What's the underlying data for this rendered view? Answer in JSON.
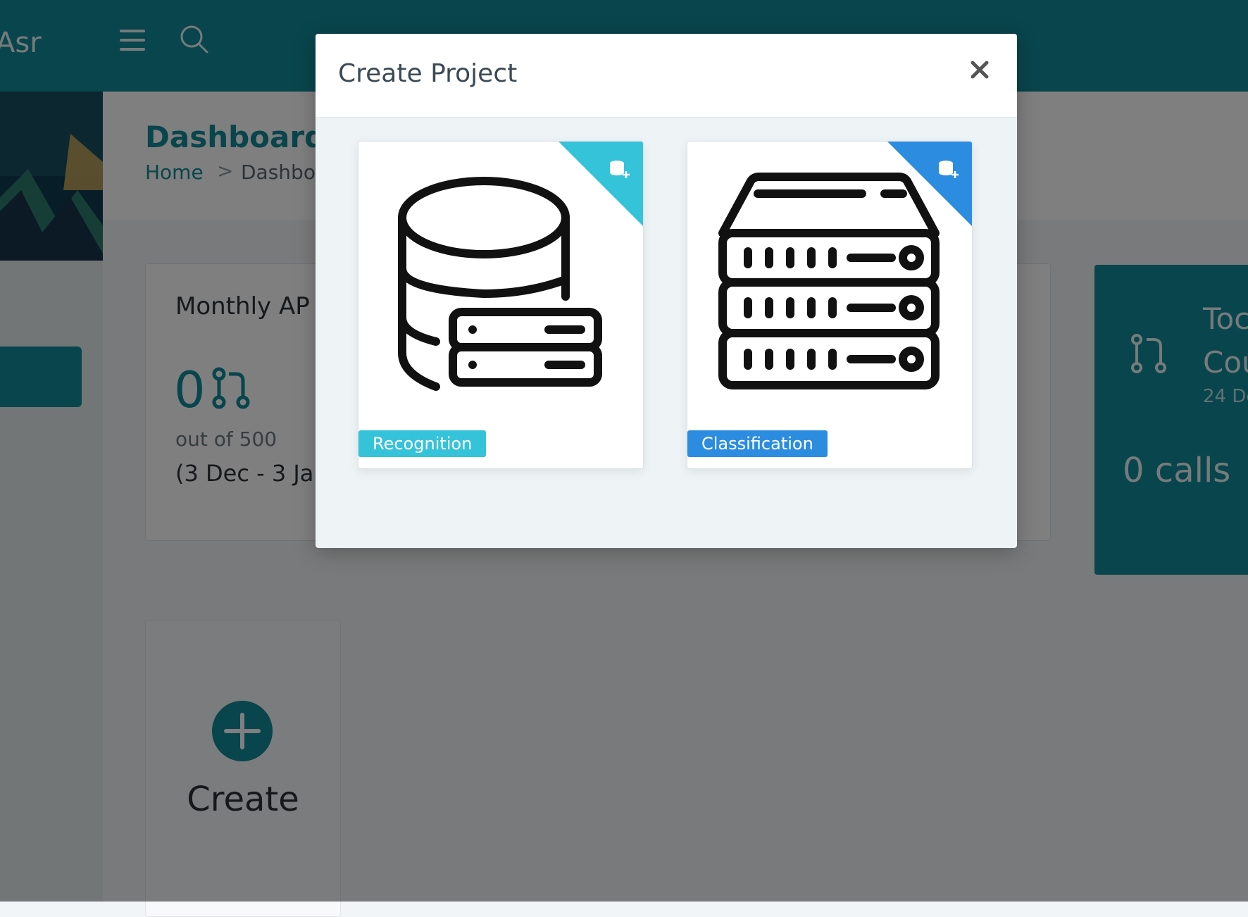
{
  "app": {
    "brand": "Asr"
  },
  "page": {
    "title": "Dashboard",
    "breadcrumb": {
      "home": "Home",
      "separator": ">",
      "current": "Dashbo"
    }
  },
  "api_card": {
    "title": "Monthly AP",
    "value": "0",
    "out_of": "out of 500",
    "range": "(3 Dec - 3 Ja"
  },
  "today_card": {
    "title_line1": "Toc",
    "title_line2": "Cou",
    "date": "24 De",
    "calls": "0 calls"
  },
  "create_card": {
    "label": "Create"
  },
  "modal": {
    "title": "Create Project",
    "close_icon": "close-icon",
    "options": [
      {
        "label": "Recognition",
        "icon": "database-server-icon",
        "color": "#35c3da"
      },
      {
        "label": "Classification",
        "icon": "server-rack-icon",
        "color": "#2c8de0"
      }
    ]
  },
  "colors": {
    "brand": "#138a99",
    "recognition": "#35c3da",
    "classification": "#2c8de0"
  }
}
